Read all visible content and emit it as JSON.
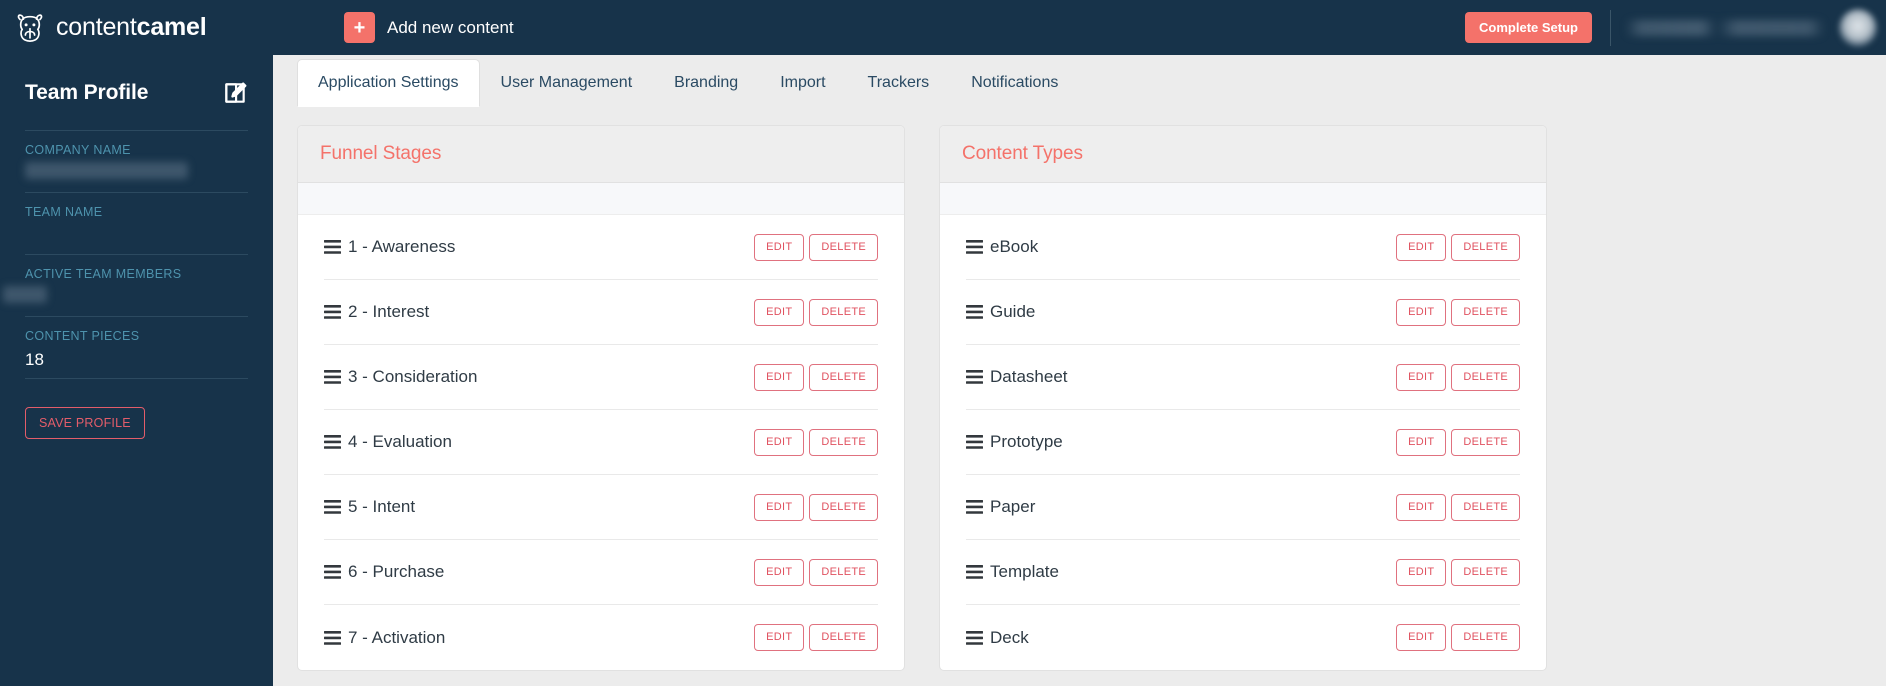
{
  "navbar": {
    "brand_light": "content",
    "brand_bold": "camel",
    "brand_logo_icon": "camel-head-icon",
    "add_content_label": "Add new content",
    "add_content_icon": "plus-icon",
    "complete_setup_label": "Complete Setup",
    "user_name": "",
    "avatar_icon": "user-avatar"
  },
  "sidebar": {
    "title": "Team Profile",
    "edit_icon": "edit-pencil-square-icon",
    "fields": [
      {
        "label": "COMPANY NAME",
        "value": "",
        "redacted": "wide"
      },
      {
        "label": "TEAM NAME",
        "value": "",
        "redacted": "none"
      },
      {
        "label": "ACTIVE TEAM MEMBERS",
        "value": "",
        "redacted": "narrow"
      },
      {
        "label": "CONTENT PIECES",
        "value": "18",
        "redacted": "none"
      }
    ],
    "save_profile_label": "SAVE PROFILE"
  },
  "tabs": [
    {
      "label": "Application Settings",
      "active": true
    },
    {
      "label": "User Management",
      "active": false
    },
    {
      "label": "Branding",
      "active": false
    },
    {
      "label": "Import",
      "active": false
    },
    {
      "label": "Trackers",
      "active": false
    },
    {
      "label": "Notifications",
      "active": false
    }
  ],
  "action_labels": {
    "edit": "EDIT",
    "delete": "DELETE"
  },
  "cards": [
    {
      "title": "Funnel Stages",
      "items": [
        "1 - Awareness",
        "2 - Interest",
        "3 - Consideration",
        "4 - Evaluation",
        "5 - Intent",
        "6 - Purchase",
        "7 - Activation"
      ]
    },
    {
      "title": "Content Types",
      "items": [
        "eBook",
        "Guide",
        "Datasheet",
        "Prototype",
        "Paper",
        "Template",
        "Deck"
      ]
    }
  ],
  "colors": {
    "navy": "#17334a",
    "coral": "#f4726a",
    "danger": "#e0515f",
    "label_blue": "#4e93ad",
    "page_bg": "#ececec"
  }
}
